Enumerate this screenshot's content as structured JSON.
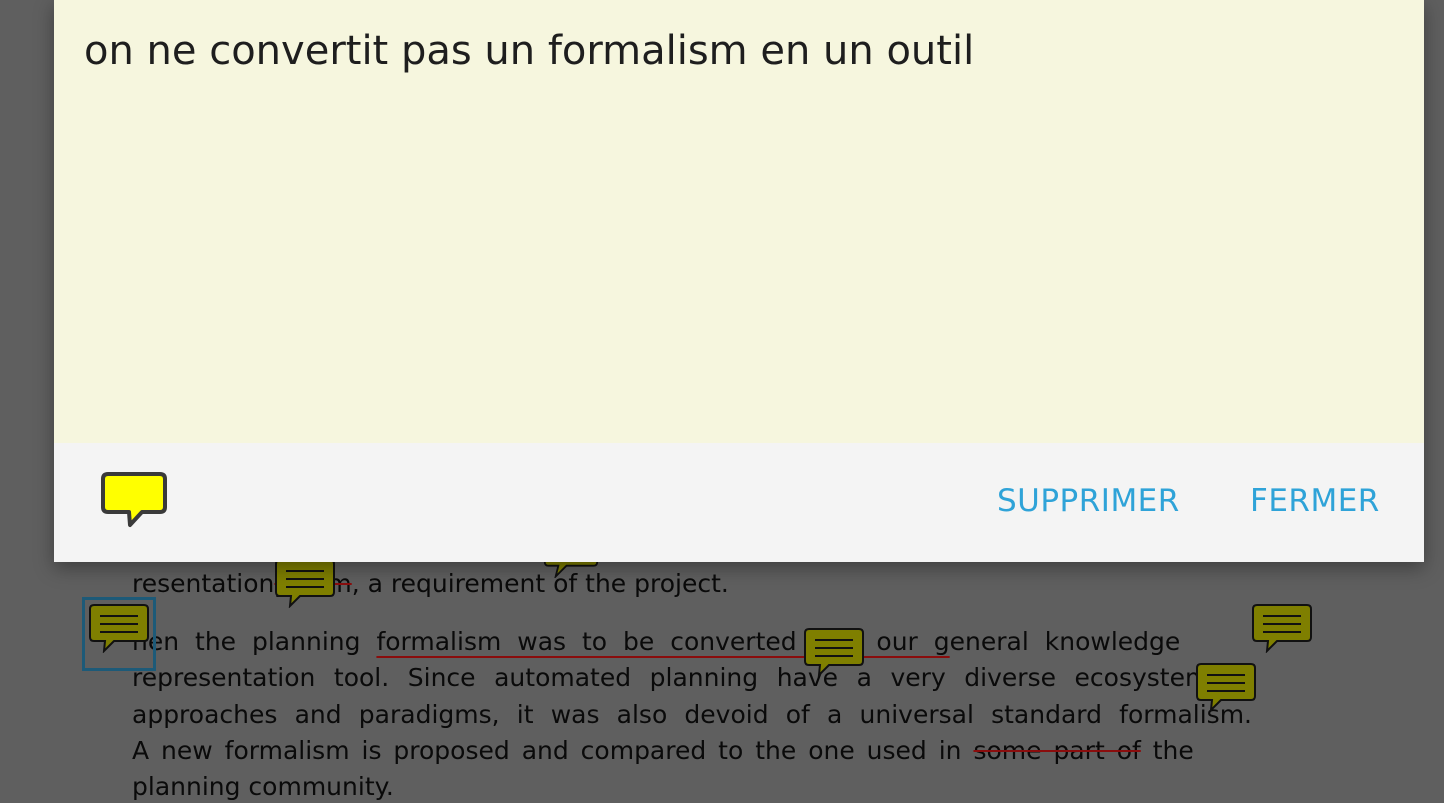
{
  "dialog": {
    "note_text": "on ne convertit pas un formalism en un outil",
    "delete_label": "SUPPRIMER",
    "close_label": "FERMER",
    "icon_color": "#ffff00"
  },
  "document": {
    "line0_a": "resentation",
    "line0_strike": "ystem",
    "line0_b": ", a requirement of the project.",
    "line1_a": "hen the planning ",
    "line1_underline": "formalism was to be converted into our g",
    "line1_b": "eneral knowledge",
    "line2": "representation tool.  Since automated planning have a very diverse ecosystem of",
    "line3": "approaches and paradigms, it was also devoid of a universal standard formalism.",
    "line4_a": "A new formalism is proposed and compared to the one used in ",
    "line4_strike": "some part of",
    "line4_b": " the",
    "line5": "planning community.",
    "note_color": "#7f7f00"
  }
}
